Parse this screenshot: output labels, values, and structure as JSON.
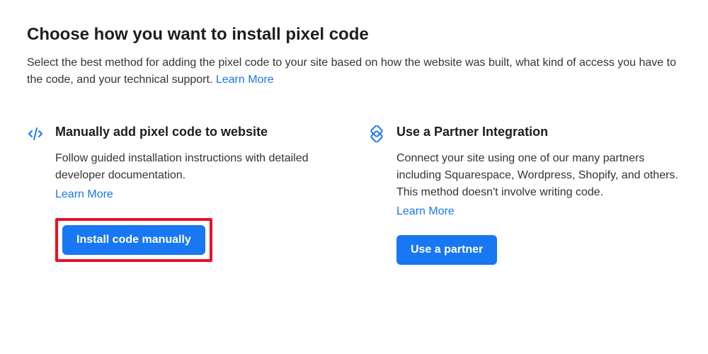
{
  "header": {
    "title": "Choose how you want to install pixel code",
    "description_prefix": "Select the best method for adding the pixel code to your site based on how the website was built, what kind of access you have to the code, and your technical support. ",
    "learn_more": "Learn More"
  },
  "options": {
    "manual": {
      "title": "Manually add pixel code to website",
      "description": "Follow guided installation instructions with detailed developer documentation.",
      "learn_more": "Learn More",
      "button_label": "Install code manually"
    },
    "partner": {
      "title": "Use a Partner Integration",
      "description": "Connect your site using one of our many partners including Squarespace, Wordpress, Shopify, and others. This method doesn't involve writing code.",
      "learn_more": "Learn More",
      "button_label": "Use a partner"
    }
  },
  "colors": {
    "accent": "#1877f2",
    "highlight_border": "#e81123"
  }
}
